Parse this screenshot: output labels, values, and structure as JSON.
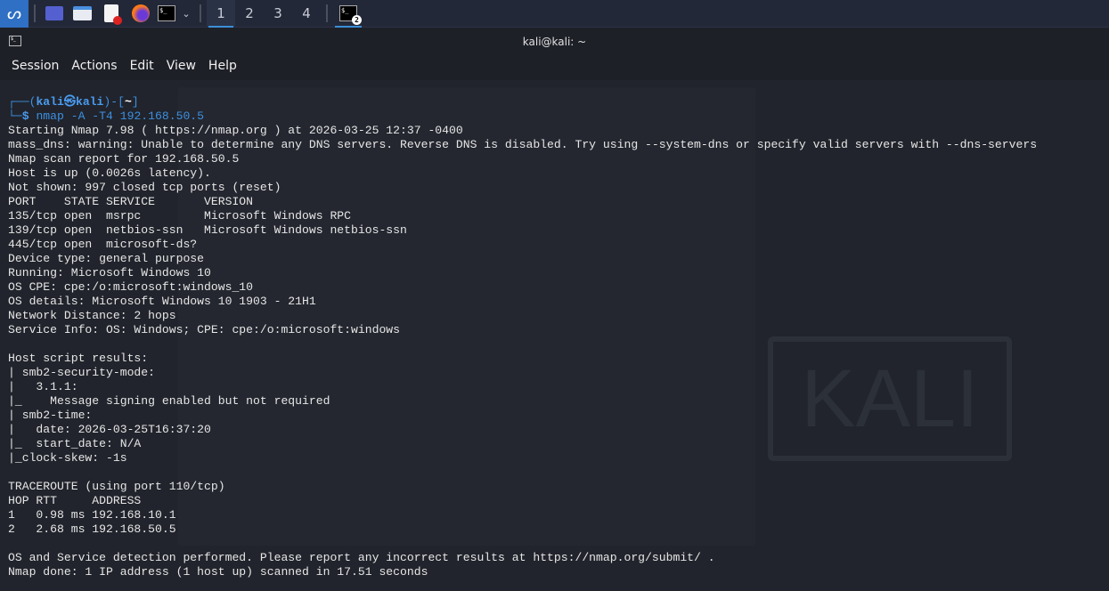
{
  "taskbar": {
    "workspaces": [
      "1",
      "2",
      "3",
      "4"
    ],
    "terminal_badge": "2",
    "terminal_icon_text": "$_"
  },
  "window": {
    "title": "kali@kali: ~"
  },
  "menu": [
    "Session",
    "Actions",
    "Edit",
    "View",
    "Help"
  ],
  "prompt": {
    "user": "kali",
    "host": "kali",
    "dir": "~",
    "symbol": "$",
    "command": "nmap -A -T4 192.168.50.5"
  },
  "output": [
    "Starting Nmap 7.98 ( https://nmap.org ) at 2026-03-25 12:37 -0400",
    "mass_dns: warning: Unable to determine any DNS servers. Reverse DNS is disabled. Try using --system-dns or specify valid servers with --dns-servers",
    "Nmap scan report for 192.168.50.5",
    "Host is up (0.0026s latency).",
    "Not shown: 997 closed tcp ports (reset)",
    "PORT    STATE SERVICE       VERSION",
    "135/tcp open  msrpc         Microsoft Windows RPC",
    "139/tcp open  netbios-ssn   Microsoft Windows netbios-ssn",
    "445/tcp open  microsoft-ds?",
    "Device type: general purpose",
    "Running: Microsoft Windows 10",
    "OS CPE: cpe:/o:microsoft:windows_10",
    "OS details: Microsoft Windows 10 1903 - 21H1",
    "Network Distance: 2 hops",
    "Service Info: OS: Windows; CPE: cpe:/o:microsoft:windows",
    "",
    "Host script results:",
    "| smb2-security-mode:",
    "|   3.1.1:",
    "|_    Message signing enabled but not required",
    "| smb2-time:",
    "|   date: 2026-03-25T16:37:20",
    "|_  start_date: N/A",
    "|_clock-skew: -1s",
    "",
    "TRACEROUTE (using port 110/tcp)",
    "HOP RTT     ADDRESS",
    "1   0.98 ms 192.168.10.1",
    "2   2.68 ms 192.168.50.5",
    "",
    "OS and Service detection performed. Please report any incorrect results at https://nmap.org/submit/ .",
    "Nmap done: 1 IP address (1 host up) scanned in 17.51 seconds"
  ],
  "wallpaper_logo": "KALI"
}
